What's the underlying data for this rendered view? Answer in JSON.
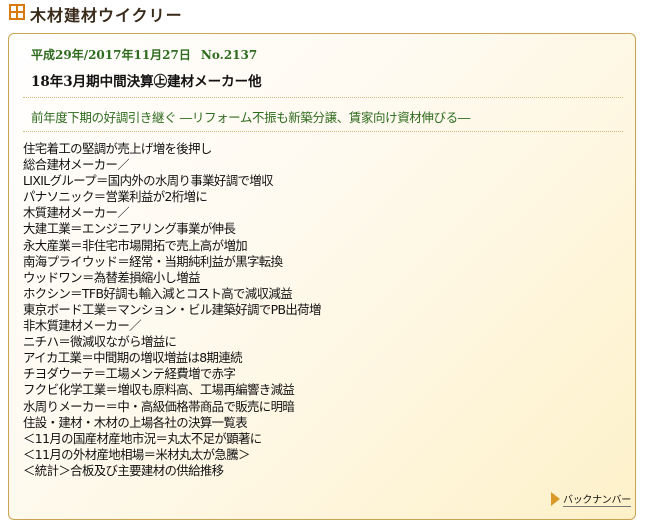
{
  "header": {
    "site_title": "木材建材ウイクリー",
    "logo_icon": "four-square-logo-icon",
    "logo_color": "#d97a10"
  },
  "article": {
    "date": "平成29年/2017年11月27日",
    "number": "No.2137",
    "title": "18年3月期中間決算㊤建材メーカー他",
    "subtitle": "前年度下期の好調引き継ぐ ―リフォーム不振も新築分譲、賃家向け資材伸びる―",
    "items": [
      "住宅着工の堅調が売上げ増を後押し",
      "総合建材メーカー／",
      "LIXILグループ＝国内外の水周り事業好調で増収",
      "パナソニック＝営業利益が2桁増に",
      "木質建材メーカー／",
      "大建工業＝エンジニアリング事業が伸長",
      "永大産業＝非住宅市場開拓で売上高が増加",
      "南海プライウッド＝経常・当期純利益が黒字転換",
      "ウッドワン＝為替差損縮小し増益",
      "ホクシン＝TFB好調も輸入減とコスト高で減収減益",
      "東京ボード工業＝マンション・ビル建築好調でPB出荷増",
      "非木質建材メーカー／",
      "ニチハ＝微減収ながら増益に",
      "アイカ工業＝中間期の増収増益は8期連続",
      "チヨダウーテ＝工場メンテ経費増で赤字",
      "フクビ化学工業＝増収も原料高、工場再編響き減益",
      "水周りメーカー＝中・高級価格帯商品で販売に明暗",
      "住設・建材・木材の上場各社の決算一覧表",
      "＜11月の国産材産地市況＝丸太不足が顕著に",
      "＜11月の外材産地相場＝米材丸太が急騰＞",
      "＜統計＞合板及び主要建材の供給推移"
    ]
  },
  "footer": {
    "back_number_label": "バックナンバー",
    "arrow_icon": "arrow-right-icon"
  },
  "colors": {
    "accent_green": "#2f6b1f",
    "panel_border": "#c9a552",
    "panel_tint": "#fdf1c9",
    "arrow": "#d99a2a"
  }
}
